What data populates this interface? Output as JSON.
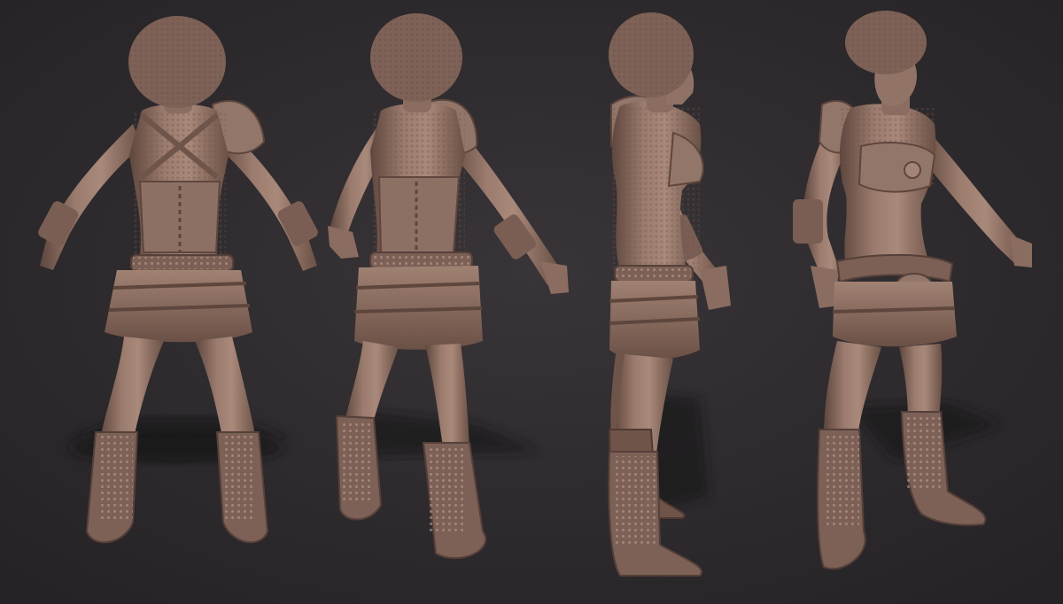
{
  "scene": {
    "colors": {
      "background": "#2e2b2e",
      "clay": "#8a6d60",
      "clay_light": "#a9897a",
      "clay_dark": "#5e463d",
      "shadow": "#1a1819"
    },
    "views": [
      {
        "id": "back",
        "label": ""
      },
      {
        "id": "back-three-quarter",
        "label": ""
      },
      {
        "id": "side",
        "label": ""
      },
      {
        "id": "front-three-quarter",
        "label": ""
      }
    ]
  }
}
